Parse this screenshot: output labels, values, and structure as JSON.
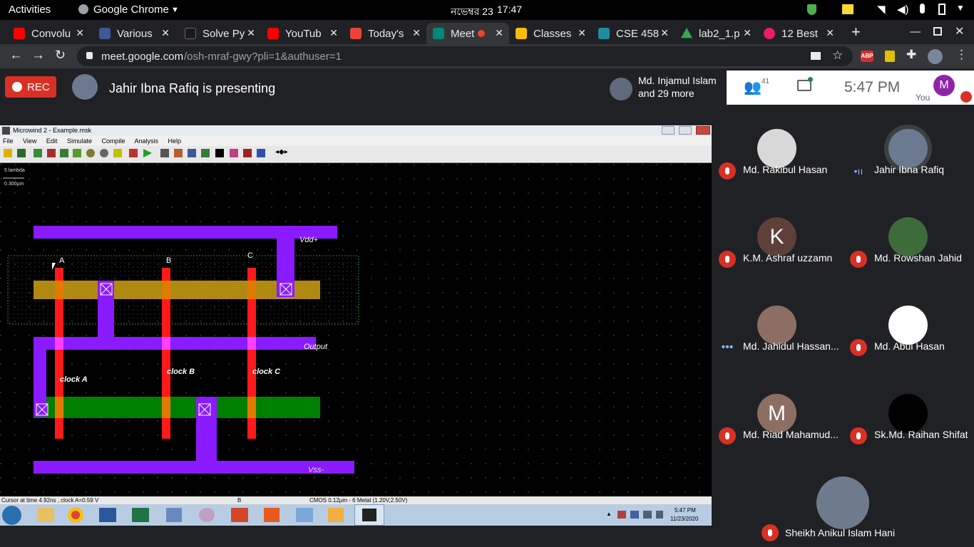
{
  "topbar": {
    "activities": "Activities",
    "app_name": "Google Chrome",
    "date": "নভেম্বর 23",
    "time": "17:47"
  },
  "tabs": [
    {
      "label": "Convolu",
      "color": "#ff0000"
    },
    {
      "label": "Various",
      "color": "#3b5998"
    },
    {
      "label": "Solve Py",
      "color": "#1a1a1a"
    },
    {
      "label": "YouTub",
      "color": "#ff0000"
    },
    {
      "label": "Today's",
      "color": "#ea4335"
    },
    {
      "label": "Meet",
      "color": "#00897b"
    },
    {
      "label": "Classes",
      "color": "#fbbc04"
    },
    {
      "label": "CSE 458",
      "color": "#1e8e9e"
    },
    {
      "label": "lab2_1.p",
      "color": "#34a853"
    },
    {
      "label": "12 Best",
      "color": "#e91e63"
    }
  ],
  "address": {
    "host": "meet.google.com",
    "path": "/osh-mraf-gwy?pli=1&authuser=1",
    "abp": "ABP"
  },
  "meet": {
    "rec_label": "REC",
    "presenting_text": "Jahir Ibna Rafiq is presenting",
    "others_line1": "Md. Injamul Islam",
    "others_line2": "and 29 more",
    "people_count": "41",
    "clock": "5:47  PM",
    "you_label": "You",
    "self_initial": "M"
  },
  "microwind": {
    "title": "Microwind 2 - Example.msk",
    "menu": [
      "File",
      "View",
      "Edit",
      "Simulate",
      "Compile",
      "Analysis",
      "Help"
    ],
    "scale_top": "5 lambda",
    "scale_bottom": "0.300µm",
    "labels": {
      "a": "A",
      "b": "B",
      "c": "C",
      "vdd": "Vdd+",
      "output": "Output",
      "vss": "Vss-",
      "clock_a": "clock A",
      "clock_b": "clock B",
      "clock_c": "clock C"
    },
    "status_left": "Cursor at  time 4.92ns , clock A=0.59 V",
    "status_mid": "B",
    "status_right": "CMOS 0.12µm - 6 Metal (1.20V,2.50V)"
  },
  "win_taskbar": {
    "time": "5:47 PM",
    "date": "11/23/2020"
  },
  "participants": [
    {
      "name": "Md. Rakibul Hasan",
      "initial": "",
      "bg": "#d8d8d8",
      "status": "muted"
    },
    {
      "name": "Jahir Ibna Rafiq",
      "initial": "",
      "bg": "#6b7a8f",
      "status": "speaking"
    },
    {
      "name": "K.M. Ashraf uzzamn",
      "initial": "K",
      "bg": "#5d4037",
      "status": "muted"
    },
    {
      "name": "Md. Rowshan Jahid",
      "initial": "",
      "bg": "#3e6b3a",
      "status": "muted"
    },
    {
      "name": "Md. Jahidul Hassan...",
      "initial": "",
      "bg": "#8d6e63",
      "status": "dots"
    },
    {
      "name": "Md. Abul Hasan",
      "initial": "",
      "bg": "#ffffff",
      "status": "muted"
    },
    {
      "name": "Md. Riad Mahamud...",
      "initial": "M",
      "bg": "#8d6e63",
      "status": "muted"
    },
    {
      "name": "Sk.Md. Raihan Shifat",
      "initial": "",
      "bg": "#000000",
      "status": "muted"
    },
    {
      "name": "Sheikh Anikul Islam Hani",
      "initial": "",
      "bg": "#6d7b8d",
      "status": "muted"
    }
  ]
}
